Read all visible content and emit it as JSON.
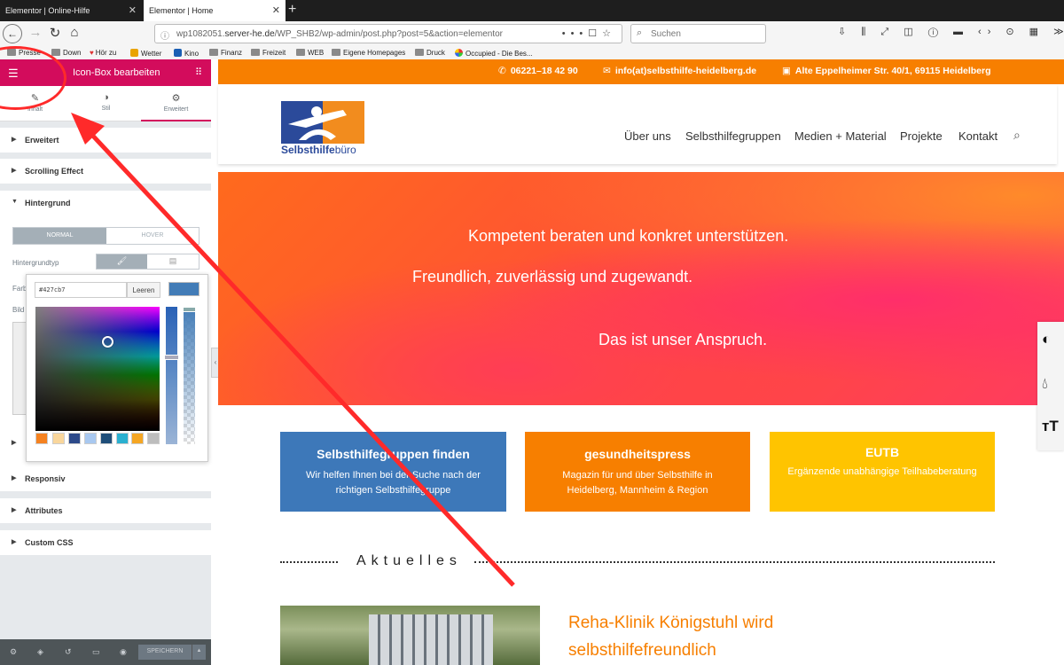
{
  "browser": {
    "tabs": [
      {
        "label": "Elementor | Online-Hilfe",
        "active": false
      },
      {
        "label": "Elementor | Home",
        "active": true
      }
    ],
    "url_prefix": "wp1082051.",
    "url_host": "server-he.de",
    "url_path": "/WP_SHB2/wp-admin/post.php?post=5&action=elementor",
    "search_placeholder": "Suchen",
    "bookmarks": [
      "Presse",
      "Down",
      "Hör zu",
      "Wetter",
      "Kino",
      "Finanz",
      "Freizeit",
      "WEB",
      "Eigene Homepages",
      "Druck",
      "Occupied - Die Bes..."
    ]
  },
  "panel": {
    "title": "Icon-Box bearbeiten",
    "tabs": [
      "Inhalt",
      "Stil",
      "Erweitert"
    ],
    "sections": {
      "erweitert": "Erweitert",
      "scrolling": "Scrolling Effect",
      "hintergrund": "Hintergrund",
      "responsiv": "Responsiv",
      "attributes": "Attributes",
      "custom_css": "Custom CSS"
    },
    "state_toggle": {
      "normal": "NORMAL",
      "hover": "HOVER"
    },
    "bg_type_label": "Hintergrundtyp",
    "color_label": "Farb",
    "image_label": "Bild",
    "picker": {
      "hex_value": "#427cb7",
      "clear_label": "Leeren",
      "current_color": "#427cb7",
      "palette": [
        "#f58220",
        "#f9d69b",
        "#2d4a8a",
        "#a8c8f0",
        "#1f4e79",
        "#2ab0d0",
        "#f5a623",
        "#bdbdbd"
      ]
    },
    "save_label": "SPEICHERN"
  },
  "site": {
    "phone": "06221–18 42 90",
    "email": "info(at)selbsthilfe-heidelberg.de",
    "address": "Alte Eppelheimer Str. 40/1, 69115 Heidelberg",
    "logo_bold": "Selbsthilfe",
    "logo_light": "büro",
    "menu": [
      "Über uns",
      "Selbsthilfegruppen",
      "Medien + Material",
      "Projekte",
      "Kontakt"
    ],
    "hero": {
      "line1": "Kompetent beraten und konkret unterstützen.",
      "line2": "Freundlich, zuverlässig und zugewandt.",
      "line3": "Das ist unser Anspruch."
    },
    "boxes": [
      {
        "title": "Selbsthilfegruppen finden",
        "text": "Wir helfen Ihnen bei der Suche nach der richtigen Selbsthilfegruppe",
        "color": "#3d78b9"
      },
      {
        "title": "gesundheitspress",
        "text": "Magazin für und über Selbsthilfe in Heidelberg, Mannheim & Region",
        "color": "#f77f00"
      },
      {
        "title": "EUTB",
        "text": "Ergänzende unabhängige Teilhabeberatung",
        "color": "#ffc400"
      }
    ],
    "news_heading": "Aktuelles",
    "news_title": "Reha-Klinik Königstuhl wird selbsthilfefreundlich"
  },
  "annotation": {
    "color": "#ff2a2a"
  }
}
